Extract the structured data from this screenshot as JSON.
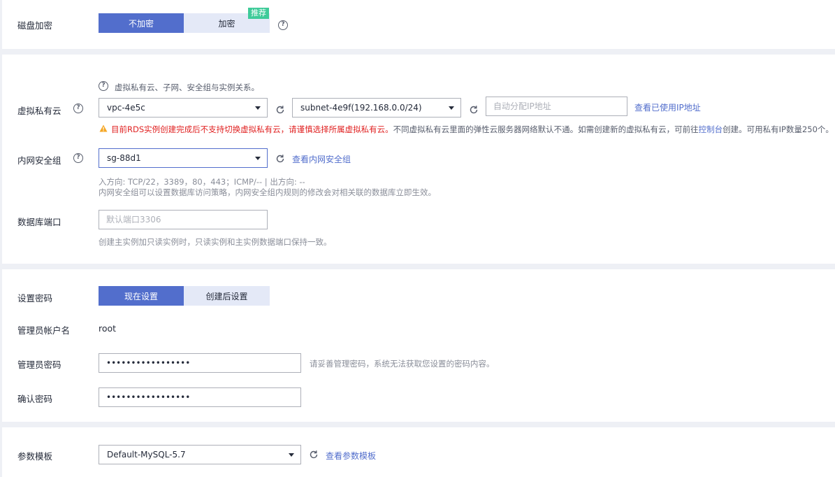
{
  "disk_encryption": {
    "label": "磁盘加密",
    "options": [
      "不加密",
      "加密"
    ],
    "selected": "不加密",
    "badge": "推荐"
  },
  "network": {
    "vpc_relation_hint": "虚拟私有云、子网、安全组与实例关系。",
    "vpc_label": "虚拟私有云",
    "vpc_value": "vpc-4e5c",
    "subnet_value": "subnet-4e9f(192.168.0.0/24)",
    "ip_placeholder": "自动分配IP地址",
    "view_used_ip": "查看已使用IP地址",
    "warning_red": "目前RDS实例创建完成后不支持切换虚拟私有云，请谨慎选择所属虚拟私有云。",
    "warning_gray_1": "不同虚拟私有云里面的弹性云服务器网络默认不通。如需创建新的虚拟私有云，可前往",
    "warning_link": "控制台",
    "warning_gray_2": "创建。可用私有IP数量250个。",
    "sg_label": "内网安全组",
    "sg_value": "sg-88d1",
    "view_sg": "查看内网安全组",
    "sg_rules": "入方向: TCP/22，3389，80，443；ICMP/-- | 出方向: --",
    "sg_desc": "内网安全组可以设置数据库访问策略，内网安全组内规则的修改会对相关联的数据库立即生效。",
    "port_label": "数据库端口",
    "port_placeholder": "默认端口3306",
    "port_hint": "创建主实例加只读实例时，只读实例和主实例数据端口保持一致。"
  },
  "password": {
    "label": "设置密码",
    "options": [
      "现在设置",
      "创建后设置"
    ],
    "selected": "现在设置",
    "admin_label": "管理员帐户名",
    "admin_value": "root",
    "admin_pwd_label": "管理员密码",
    "admin_pwd_value": "•••••••••••••••••",
    "admin_pwd_hint": "请妥善管理密码，系统无法获取您设置的密码内容。",
    "confirm_label": "确认密码",
    "confirm_value": "•••••••••••••••••"
  },
  "params": {
    "label": "参数模板",
    "value": "Default-MySQL-5.7",
    "view_link": "查看参数模板"
  },
  "colors": {
    "accent": "#526ecc",
    "warning_red": "#e02020",
    "badge_green": "#3ecb99",
    "warning_icon": "#f5a623"
  }
}
